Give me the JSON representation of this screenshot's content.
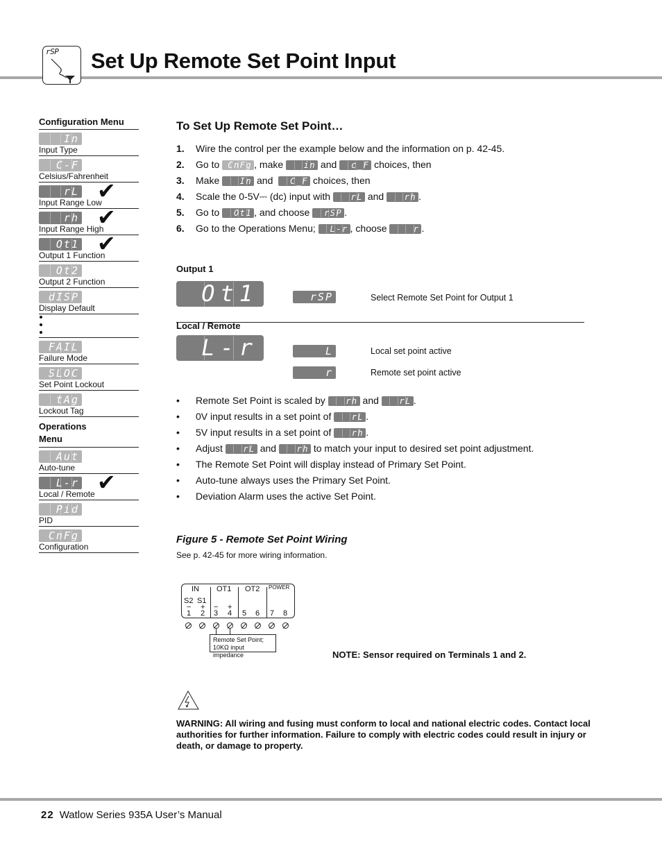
{
  "header": {
    "icon_code": "rSP",
    "title": "Set Up Remote Set Point Input"
  },
  "sidebar": {
    "config_heading": "Configuration Menu",
    "config_items": [
      {
        "code": "In",
        "label": "Input Type",
        "checked": false,
        "shade": "light"
      },
      {
        "code": "C-F",
        "label": "Celsius/Fahrenheit",
        "checked": false,
        "shade": "light"
      },
      {
        "code": "rL",
        "label": "Input Range Low",
        "checked": true,
        "shade": "dark"
      },
      {
        "code": "rh",
        "label": "Input Range High",
        "checked": true,
        "shade": "dark"
      },
      {
        "code": "Ot1",
        "label": "Output 1 Function",
        "checked": true,
        "shade": "dark"
      },
      {
        "code": "Ot2",
        "label": "Output 2 Function",
        "checked": false,
        "shade": "light"
      },
      {
        "code": "dISP",
        "label": "Display Default",
        "checked": false,
        "shade": "light"
      }
    ],
    "config_items_after": [
      {
        "code": "FAIL",
        "label": "Failure Mode",
        "checked": false,
        "shade": "light"
      },
      {
        "code": "SLOC",
        "label": "Set Point Lockout",
        "checked": false,
        "shade": "light"
      },
      {
        "code": "tAg",
        "label": "Lockout Tag",
        "checked": false,
        "shade": "light"
      }
    ],
    "ops_heading_1": "Operations",
    "ops_heading_2": "Menu",
    "ops_items": [
      {
        "code": "Aut",
        "label": "Auto-tune",
        "checked": false,
        "shade": "light"
      },
      {
        "code": "L-r",
        "label": "Local / Remote",
        "checked": true,
        "shade": "dark"
      },
      {
        "code": "Pid",
        "label": "PID",
        "checked": false,
        "shade": "light"
      },
      {
        "code": "CnFg",
        "label": "Configuration",
        "checked": false,
        "shade": "light"
      }
    ],
    "check_glyph": "✔"
  },
  "main": {
    "heading": "To Set Up Remote Set Point…",
    "steps": [
      {
        "n": "1.",
        "parts": [
          {
            "t": "Wire the control per the example below and the information on p. 42-45."
          }
        ]
      },
      {
        "n": "2.",
        "parts": [
          {
            "t": "Go to "
          },
          {
            "led": "CnFg"
          },
          {
            "t": ", make "
          },
          {
            "led": "in"
          },
          {
            "t": " and "
          },
          {
            "led": "c_F"
          },
          {
            "t": " choices, then"
          }
        ]
      },
      {
        "n": "3.",
        "parts": [
          {
            "t": "Make "
          },
          {
            "led": "In"
          },
          {
            "t": " and  "
          },
          {
            "led": "C_F"
          },
          {
            "t": " choices, then"
          }
        ]
      },
      {
        "n": "4.",
        "parts": [
          {
            "t": "Scale the 0-5V⎓ (dc) input with "
          },
          {
            "led": "rL"
          },
          {
            "t": " and "
          },
          {
            "led": "rh"
          },
          {
            "t": "."
          }
        ]
      },
      {
        "n": "5.",
        "parts": [
          {
            "t": "Go to "
          },
          {
            "led": "Ot1"
          },
          {
            "t": ", and choose "
          },
          {
            "led": "rSP"
          },
          {
            "t": "."
          }
        ]
      },
      {
        "n": "6.",
        "parts": [
          {
            "t": "Go to the Operations Menu; "
          },
          {
            "led": "L-r"
          },
          {
            "t": ", choose "
          },
          {
            "led": "r"
          },
          {
            "t": "."
          }
        ]
      }
    ],
    "output1": {
      "heading": "Output 1",
      "display": "Ot1",
      "option": "rSP",
      "option_desc": "Select Remote Set Point for Output 1"
    },
    "local_remote": {
      "heading": "Local / Remote",
      "display": "L-r",
      "options": [
        {
          "code": "L",
          "desc": "Local set point active"
        },
        {
          "code": "r",
          "desc": "Remote set point active"
        }
      ]
    },
    "bullets": [
      {
        "parts": [
          {
            "t": "Remote Set Point is scaled by "
          },
          {
            "led": "rh"
          },
          {
            "t": " and "
          },
          {
            "led": "rL"
          },
          {
            "t": "."
          }
        ]
      },
      {
        "parts": [
          {
            "t": "0V input results in a set point of "
          },
          {
            "led": "rL"
          },
          {
            "t": "."
          }
        ]
      },
      {
        "parts": [
          {
            "t": "5V input results in a set point of "
          },
          {
            "led": "rh"
          },
          {
            "t": "."
          }
        ]
      },
      {
        "parts": [
          {
            "t": "Adjust "
          },
          {
            "led": "rL"
          },
          {
            "t": " and "
          },
          {
            "led": "rh"
          },
          {
            "t": " to match your input to desired set point adjustment."
          }
        ]
      },
      {
        "parts": [
          {
            "t": "The Remote Set Point will display instead of Primary Set Point."
          }
        ]
      },
      {
        "parts": [
          {
            "t": "Auto-tune always uses the Primary Set Point."
          }
        ]
      },
      {
        "parts": [
          {
            "t": "Deviation Alarm uses the active Set Point."
          }
        ]
      }
    ],
    "figure": {
      "title": "Figure 5 - Remote Set Point Wiring",
      "subtitle": "See p. 42-45 for more wiring information.",
      "groups": [
        "IN",
        "OT1",
        "OT2",
        "POWER"
      ],
      "sub_labels": [
        "S2",
        "S1"
      ],
      "polarity": [
        "−",
        "+",
        "−",
        "+"
      ],
      "terminals": [
        "1",
        "2",
        "3",
        "4",
        "5",
        "6",
        "7",
        "8"
      ],
      "callout_line1": "Remote Set Point;",
      "callout_line2": "10KΩ  input impedance"
    },
    "note": "NOTE: Sensor required on Terminals 1 and 2.",
    "warning": "WARNING: All wiring and fusing must conform to local and national electric codes. Contact local authorities for further information. Failure to comply with electric codes could result in injury or death, or damage to property."
  },
  "footer": {
    "page_number": "22",
    "manual_title": "Watlow Series 935A User’s Manual"
  }
}
